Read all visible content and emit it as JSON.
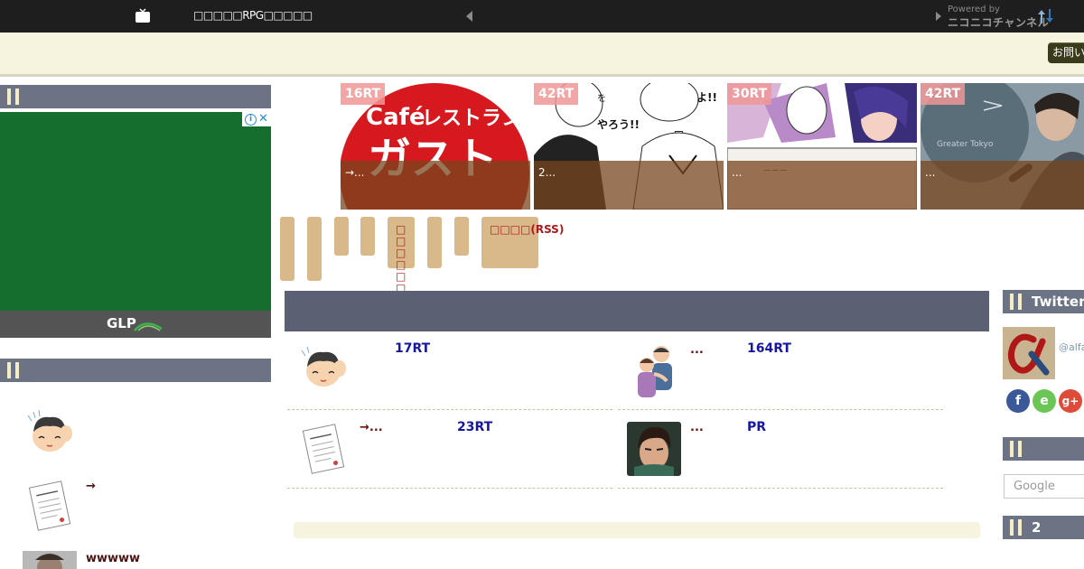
{
  "topbar": {
    "title": "□□□□□RPG□□□□□",
    "powered_by": "Powered by",
    "niconico": "ニコニコチャンネル"
  },
  "header": {
    "contact_label": "お問い"
  },
  "left": {
    "section1_label": "",
    "section2_label": "",
    "ad_logo": "GLP",
    "items": [
      {
        "text": ""
      },
      {
        "text": "→"
      },
      {
        "text": "wwwww"
      }
    ]
  },
  "slider": {
    "slides": [
      {
        "rt": "16RT",
        "caption": "→...",
        "image": "Café レストラン ガスト"
      },
      {
        "rt": "42RT",
        "caption": "2...",
        "image": "manga panel"
      },
      {
        "rt": "30RT",
        "caption": "...",
        "image": "manga panel"
      },
      {
        "rt": "42RT",
        "caption": "...",
        "image": "Greater Tokyo presentation"
      }
    ]
  },
  "categories": {
    "rss_tab": "□□□□(RSS)",
    "kanji_tab": "□□□□□□"
  },
  "main": {
    "header_title": "",
    "items": [
      {
        "title": "",
        "rt": "17RT",
        "thumb": "person-thinking"
      },
      {
        "title": "...",
        "rt": "164RT",
        "thumb": "hugging-people"
      },
      {
        "title": "→...",
        "rt": "23RT",
        "thumb": "document"
      },
      {
        "title": "...",
        "rt": "PR",
        "thumb": "game-character"
      }
    ]
  },
  "right": {
    "twitter_label": "Twitter",
    "twitter_handle": "@alfa",
    "section2_label": "",
    "section3_label": "2",
    "search_placeholder": "Google",
    "social": [
      {
        "label": "f",
        "name": "facebook",
        "color": "#3b5998"
      },
      {
        "label": "e",
        "name": "feedly",
        "color": "#6cc655"
      },
      {
        "label": "g+",
        "name": "google-plus",
        "color": "#dd4b39"
      }
    ]
  }
}
